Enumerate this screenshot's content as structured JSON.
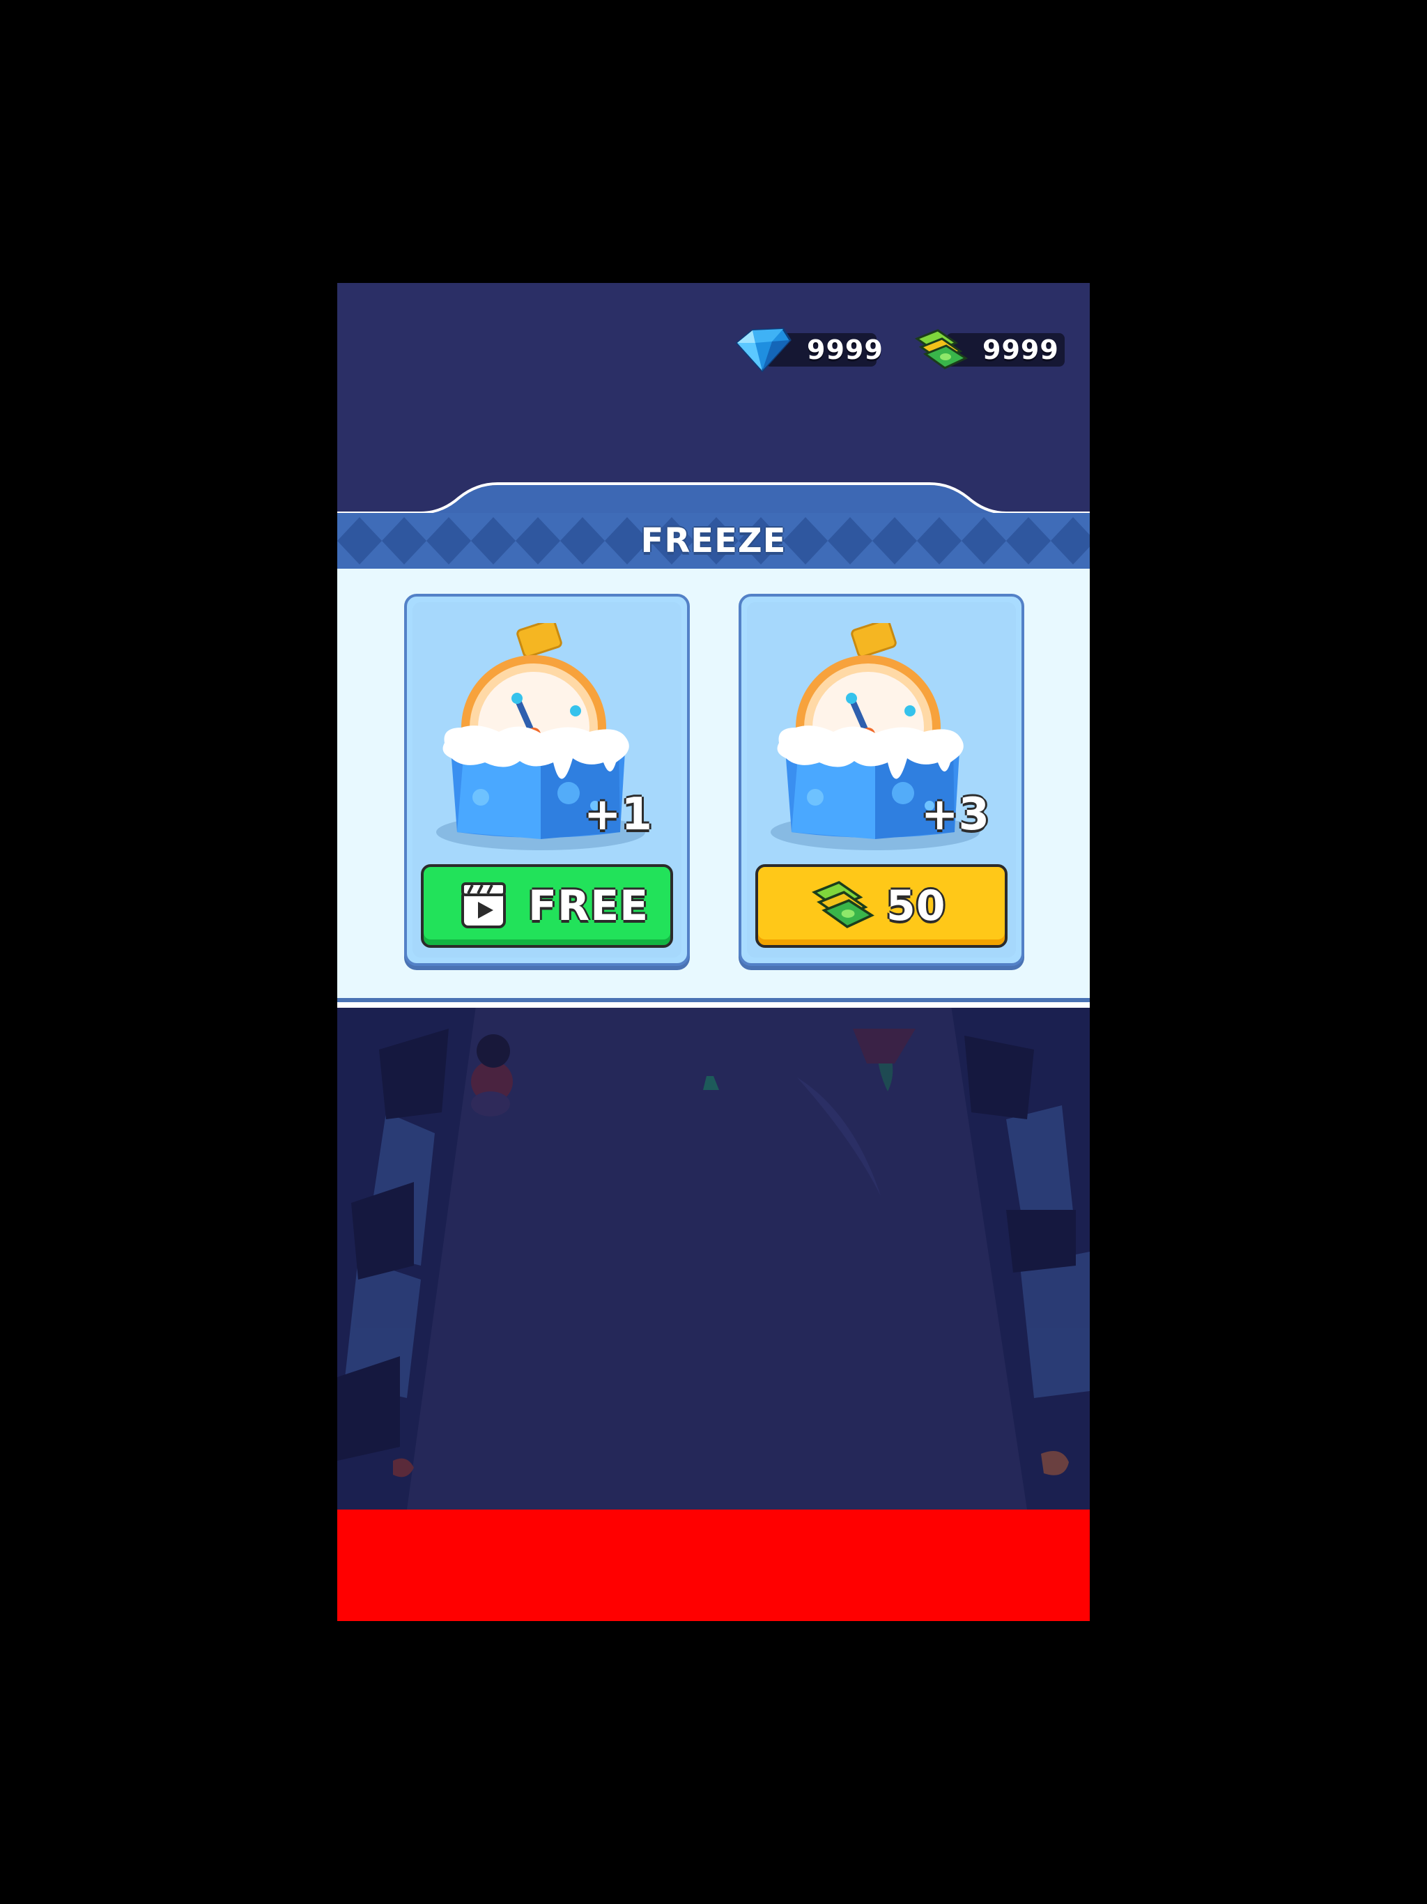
{
  "currencies": {
    "gems": {
      "value": "9999",
      "icon": "gem-icon"
    },
    "cash": {
      "value": "9999",
      "icon": "cash-icon"
    }
  },
  "panel": {
    "title": "FREEZE",
    "options": [
      {
        "amount": "+1",
        "button_label": "FREE",
        "button_icon": "video-ad-icon",
        "button_color": "#22e25a"
      },
      {
        "amount": "+3",
        "button_label": "50",
        "button_icon": "cash-icon",
        "button_color": "#ffc818"
      }
    ]
  },
  "colors": {
    "title_band": "#3d68b4",
    "panel_bg": "#e8f9ff",
    "card_bg": "#a9dcff",
    "bottom_bar": "#ff0000"
  }
}
